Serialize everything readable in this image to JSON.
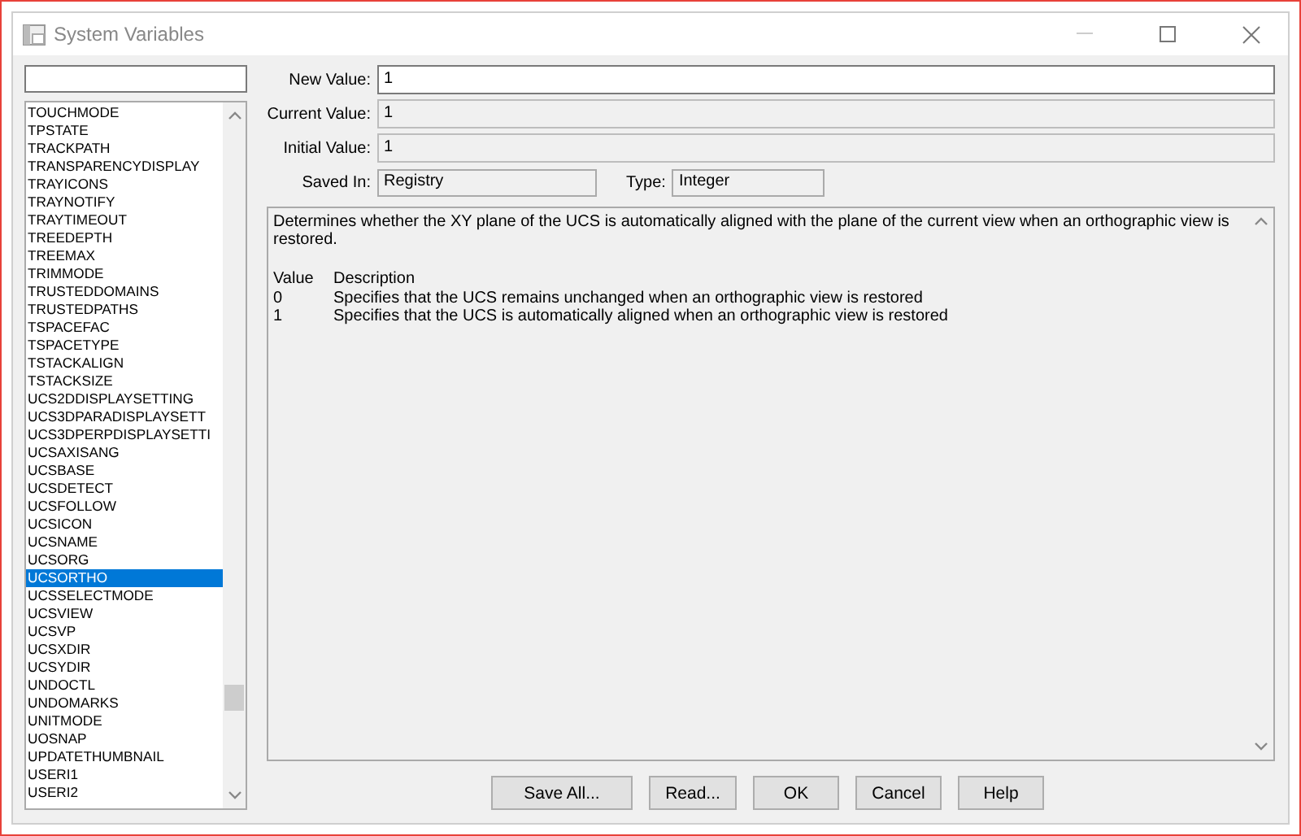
{
  "window": {
    "title": "System Variables"
  },
  "variables": [
    {
      "name": "TOUCHMODE",
      "selected": false
    },
    {
      "name": "TPSTATE",
      "selected": false
    },
    {
      "name": "TRACKPATH",
      "selected": false
    },
    {
      "name": "TRANSPARENCYDISPLAY",
      "selected": false
    },
    {
      "name": "TRAYICONS",
      "selected": false
    },
    {
      "name": "TRAYNOTIFY",
      "selected": false
    },
    {
      "name": "TRAYTIMEOUT",
      "selected": false
    },
    {
      "name": "TREEDEPTH",
      "selected": false
    },
    {
      "name": "TREEMAX",
      "selected": false
    },
    {
      "name": "TRIMMODE",
      "selected": false
    },
    {
      "name": "TRUSTEDDOMAINS",
      "selected": false
    },
    {
      "name": "TRUSTEDPATHS",
      "selected": false
    },
    {
      "name": "TSPACEFAC",
      "selected": false
    },
    {
      "name": "TSPACETYPE",
      "selected": false
    },
    {
      "name": "TSTACKALIGN",
      "selected": false
    },
    {
      "name": "TSTACKSIZE",
      "selected": false
    },
    {
      "name": "UCS2DDISPLAYSETTING",
      "selected": false
    },
    {
      "name": "UCS3DPARADISPLAYSETT",
      "selected": false
    },
    {
      "name": "UCS3DPERPDISPLAYSETTI",
      "selected": false
    },
    {
      "name": "UCSAXISANG",
      "selected": false
    },
    {
      "name": "UCSBASE",
      "selected": false
    },
    {
      "name": "UCSDETECT",
      "selected": false
    },
    {
      "name": "UCSFOLLOW",
      "selected": false
    },
    {
      "name": "UCSICON",
      "selected": false
    },
    {
      "name": "UCSNAME",
      "selected": false
    },
    {
      "name": "UCSORG",
      "selected": false
    },
    {
      "name": "UCSORTHO",
      "selected": true
    },
    {
      "name": "UCSSELECTMODE",
      "selected": false
    },
    {
      "name": "UCSVIEW",
      "selected": false
    },
    {
      "name": "UCSVP",
      "selected": false
    },
    {
      "name": "UCSXDIR",
      "selected": false
    },
    {
      "name": "UCSYDIR",
      "selected": false
    },
    {
      "name": "UNDOCTL",
      "selected": false
    },
    {
      "name": "UNDOMARKS",
      "selected": false
    },
    {
      "name": "UNITMODE",
      "selected": false
    },
    {
      "name": "UOSNAP",
      "selected": false
    },
    {
      "name": "UPDATETHUMBNAIL",
      "selected": false
    },
    {
      "name": "USERI1",
      "selected": false
    },
    {
      "name": "USERI2",
      "selected": false
    }
  ],
  "fields": [
    {
      "label": "New Value:",
      "value": "1",
      "editable": true
    },
    {
      "label": "Current Value:",
      "value": "1",
      "editable": false
    },
    {
      "label": "Initial Value:",
      "value": "1",
      "editable": false
    }
  ],
  "saved_in": {
    "label": "Saved In:",
    "value": "Registry"
  },
  "type": {
    "label": "Type:",
    "value": "Integer"
  },
  "description": {
    "text": "Determines whether the XY plane of the UCS is automatically aligned with the plane of the current view when an orthographic view is restored.",
    "columns": [
      "Value",
      "Description"
    ],
    "rows": [
      [
        "0",
        "Specifies that the UCS remains unchanged when an orthographic view is restored"
      ],
      [
        "1",
        "Specifies that the UCS is automatically aligned when an orthographic view is restored"
      ]
    ]
  },
  "buttons": [
    "Save All...",
    "Read...",
    "OK",
    "Cancel",
    "Help"
  ]
}
